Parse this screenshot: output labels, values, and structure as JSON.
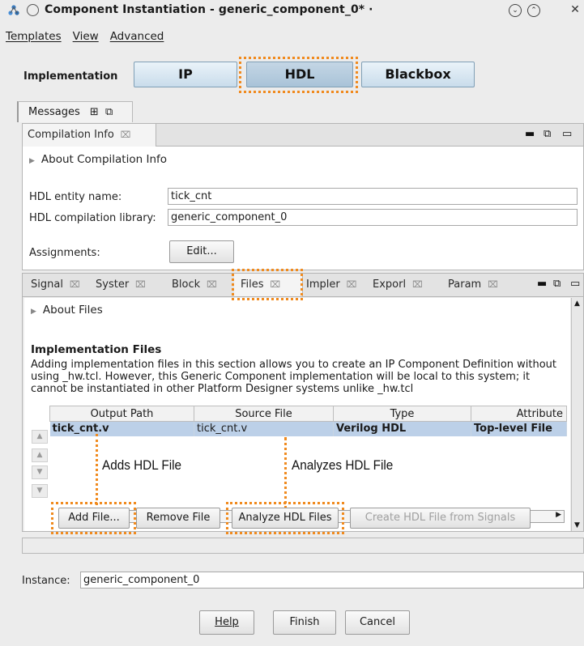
{
  "window": {
    "title": "Component Instantiation - generic_component_0* ·"
  },
  "menu": {
    "items": [
      "Templates",
      "View",
      "Advanced"
    ]
  },
  "implementation": {
    "label": "Implementation",
    "options": [
      "IP",
      "HDL",
      "Blackbox"
    ],
    "selected": "HDL"
  },
  "messages_tab": {
    "label": "Messages"
  },
  "compilation": {
    "tab_label": "Compilation Info",
    "about": "About Compilation Info",
    "entity_label": "HDL entity name:",
    "entity_value": "tick_cnt",
    "library_label": "HDL compilation library:",
    "library_value": "generic_component_0",
    "assignments_label": "Assignments:",
    "edit_button": "Edit..."
  },
  "tabs": [
    "Signal",
    "Syster",
    "Block",
    "Files",
    "Impler",
    "Exporl",
    "Param"
  ],
  "files": {
    "about": "About Files",
    "section_title": "Implementation Files",
    "description": "Adding implementation files in this section allows you to create an IP Component Definition without using _hw.tcl. However, this Generic Component implementation will be local to this system; it cannot be instantiated in other Platform Designer systems unlike _hw.tcl",
    "columns": [
      "Output Path",
      "Source File",
      "Type",
      "Attribute"
    ],
    "rows": [
      {
        "output_path": "tick_cnt.v",
        "source_file": "tick_cnt.v",
        "type": "Verilog HDL",
        "attribute": "Top-level File"
      }
    ],
    "buttons": {
      "add": "Add File...",
      "remove": "Remove File",
      "analyze": "Analyze HDL Files",
      "create": "Create HDL File from Signals"
    }
  },
  "annotations": {
    "adds": "Adds HDL File",
    "analyzes": "Analyzes HDL File"
  },
  "instance": {
    "label": "Instance:",
    "value": "generic_component_0"
  },
  "footer": {
    "help": "Help",
    "finish": "Finish",
    "cancel": "Cancel"
  },
  "colors": {
    "highlight": "#f08a1e",
    "selected_row": "#bcd0e8",
    "impl_button": "#c9dceb"
  }
}
